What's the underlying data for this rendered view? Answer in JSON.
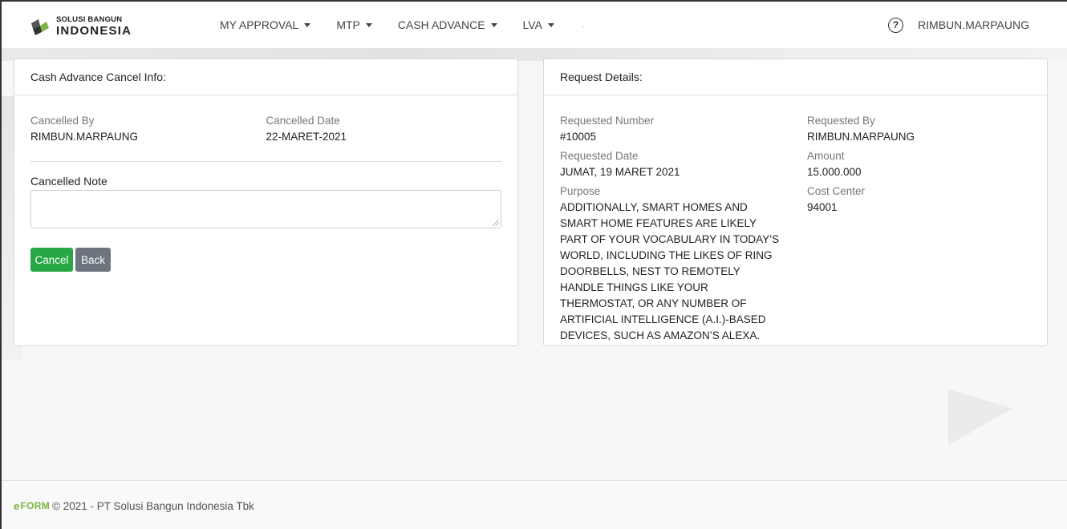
{
  "navbar": {
    "logo": {
      "line1": "SOLUSI BANGUN",
      "line2": "INDONESIA"
    },
    "menu": [
      {
        "label": "MY APPROVAL"
      },
      {
        "label": "MTP"
      },
      {
        "label": "CASH ADVANCE"
      },
      {
        "label": "LVA"
      }
    ],
    "extra_dot": ".",
    "help_icon": "question-circle-icon",
    "username": "RIMBUN.MARPAUNG"
  },
  "cancel_info": {
    "title": "Cash Advance Cancel Info:",
    "cancelled_by_label": "Cancelled By",
    "cancelled_by": "RIMBUN.MARPAUNG",
    "cancelled_date_label": "Cancelled Date",
    "cancelled_date": "22-MARET-2021",
    "note_label": "Cancelled Note",
    "note_value": "",
    "cancel_button": "Cancel",
    "back_button": "Back"
  },
  "request_details": {
    "title": "Request Details:",
    "requested_number_label": "Requested Number",
    "requested_number": "#10005",
    "requested_date_label": "Requested Date",
    "requested_date": "JUMAT, 19 MARET 2021",
    "purpose_label": "Purpose",
    "purpose": "ADDITIONALLY, SMART HOMES AND SMART HOME FEATURES ARE LIKELY PART OF YOUR VOCABULARY IN TODAY’S WORLD, INCLUDING THE LIKES OF RING DOORBELLS, NEST TO REMOTELY HANDLE THINGS LIKE YOUR THERMOSTAT, OR ANY NUMBER OF ARTIFICIAL INTELLIGENCE (A.I.)-BASED DEVICES, SUCH AS AMAZON’S ALEXA.",
    "requested_by_label": "Requested By",
    "requested_by": "RIMBUN.MARPAUNG",
    "amount_label": "Amount",
    "amount": "15.000.000",
    "cost_center_label": "Cost Center",
    "cost_center": "94001"
  },
  "footer": {
    "brand_e": "e",
    "brand_text": "FORM",
    "copyright": "© 2021 - PT Solusi Bangun Indonesia Tbk"
  },
  "colors": {
    "cancel_button": "#28a745",
    "back_button": "#6c757d",
    "brand_green": "#7cb342"
  }
}
